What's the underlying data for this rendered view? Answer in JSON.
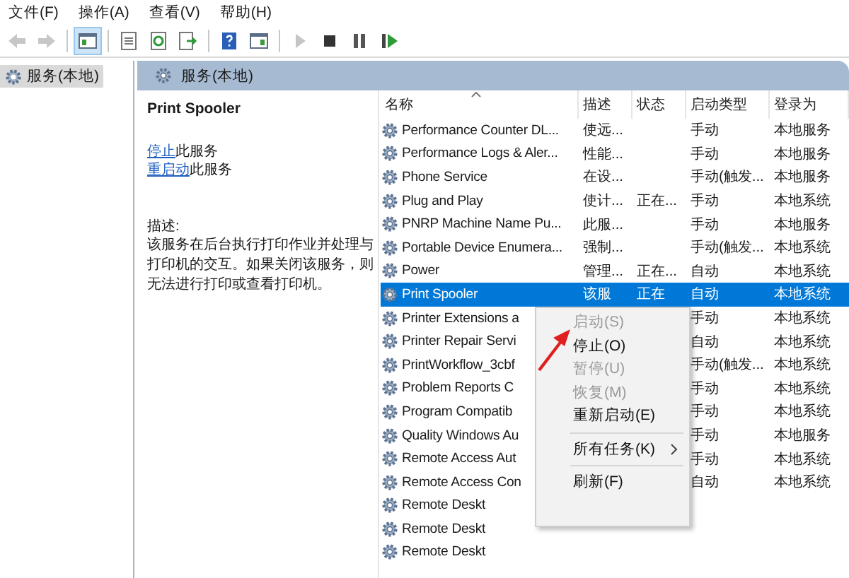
{
  "menubar": [
    "文件(F)",
    "操作(A)",
    "查看(V)",
    "帮助(H)"
  ],
  "toolbar": [
    {
      "kind": "back",
      "pressed": false,
      "disabled": true
    },
    {
      "kind": "forward",
      "pressed": false,
      "disabled": true
    },
    {
      "kind": "separator"
    },
    {
      "kind": "tree",
      "pressed": true,
      "disabled": false
    },
    {
      "kind": "separator"
    },
    {
      "kind": "properties",
      "pressed": false,
      "disabled": false
    },
    {
      "kind": "refresh",
      "pressed": false,
      "disabled": false
    },
    {
      "kind": "export",
      "pressed": false,
      "disabled": false
    },
    {
      "kind": "separator"
    },
    {
      "kind": "help",
      "pressed": false,
      "disabled": false
    },
    {
      "kind": "view",
      "pressed": false,
      "disabled": false
    },
    {
      "kind": "separator"
    },
    {
      "kind": "play",
      "pressed": false,
      "disabled": true
    },
    {
      "kind": "stop",
      "pressed": false,
      "disabled": false
    },
    {
      "kind": "pause",
      "pressed": false,
      "disabled": false
    },
    {
      "kind": "resume",
      "pressed": false,
      "disabled": false
    }
  ],
  "tree": {
    "items": [
      {
        "label": "服务(本地)",
        "selected": true
      }
    ]
  },
  "panel": {
    "title": "服务(本地)",
    "details": {
      "service_name": "Print Spooler",
      "actions": [
        {
          "link": "停止",
          "text": "此服务"
        },
        {
          "link": "重启动",
          "text": "此服务"
        }
      ],
      "description_label": "描述:",
      "description": "该服务在后台执行打印作业并处理与打印机的交互。如果关闭该服务，则无法进行打印或查看打印机。"
    },
    "table": {
      "columns": [
        {
          "label": "名称",
          "sorted": true
        },
        {
          "label": "描述",
          "sorted": false
        },
        {
          "label": "状态",
          "sorted": false
        },
        {
          "label": "启动类型",
          "sorted": false
        },
        {
          "label": "登录为",
          "sorted": false
        }
      ],
      "rows": [
        {
          "name": "Performance Counter DL...",
          "description": "使远...",
          "startup": "手动",
          "logon": "本地服务",
          "selected": false
        },
        {
          "name": "Performance Logs & Aler...",
          "description": "性能...",
          "startup": "手动",
          "logon": "本地服务",
          "selected": false
        },
        {
          "name": "Phone Service",
          "description": "在设...",
          "startup": "手动(触发...",
          "logon": "本地服务",
          "selected": false
        },
        {
          "name": "Plug and Play",
          "description": "使计...",
          "status": "正在...",
          "startup": "手动",
          "logon": "本地系统",
          "selected": false
        },
        {
          "name": "PNRP Machine Name Pu...",
          "description": "此服...",
          "startup": "手动",
          "logon": "本地服务",
          "selected": false
        },
        {
          "name": "Portable Device Enumera...",
          "description": "强制...",
          "startup": "手动(触发...",
          "logon": "本地系统",
          "selected": false
        },
        {
          "name": "Power",
          "description": "管理...",
          "status": "正在...",
          "startup": "自动",
          "logon": "本地系统",
          "selected": false
        },
        {
          "name": "Print Spooler",
          "description": "该服",
          "status": "正在",
          "startup": "自动",
          "logon": "本地系统",
          "selected": true
        },
        {
          "name": "Printer Extensions a",
          "startup": "手动",
          "logon": "本地系统",
          "selected": false
        },
        {
          "name": "Printer Repair Servi",
          "startup": "自动",
          "logon": "本地系统",
          "selected": false
        },
        {
          "name": "PrintWorkflow_3cbf",
          "startup": "手动(触发...",
          "logon": "本地系统",
          "selected": false
        },
        {
          "name": "Problem Reports C",
          "startup": "手动",
          "logon": "本地系统",
          "selected": false
        },
        {
          "name": "Program Compatib",
          "startup": "手动",
          "logon": "本地系统",
          "selected": false
        },
        {
          "name": "Quality Windows Au",
          "startup": "手动",
          "logon": "本地服务",
          "selected": false
        },
        {
          "name": "Remote Access Aut",
          "startup": "手动",
          "logon": "本地系统",
          "selected": false
        },
        {
          "name": "Remote Access Con",
          "startup": "自动",
          "logon": "本地系统",
          "selected": false
        },
        {
          "name": "Remote Deskt",
          "selected": false
        },
        {
          "name": "Remote Deskt",
          "selected": false
        },
        {
          "name": "Remote Deskt",
          "selected": false
        }
      ]
    }
  },
  "context_menu": {
    "items": [
      {
        "kind": "item",
        "label": "启动(S)",
        "disabled": true
      },
      {
        "kind": "item",
        "label": "停止(O)",
        "disabled": false
      },
      {
        "kind": "item",
        "label": "暂停(U)",
        "disabled": true
      },
      {
        "kind": "item",
        "label": "恢复(M)",
        "disabled": true
      },
      {
        "kind": "item",
        "label": "重新启动(E)",
        "disabled": false
      },
      {
        "kind": "separator"
      },
      {
        "kind": "submenu",
        "label": "所有任务(K)",
        "disabled": false
      },
      {
        "kind": "separator"
      },
      {
        "kind": "item",
        "label": "刷新(F)",
        "disabled": false
      }
    ]
  },
  "annotation": {
    "kind": "arrow"
  }
}
